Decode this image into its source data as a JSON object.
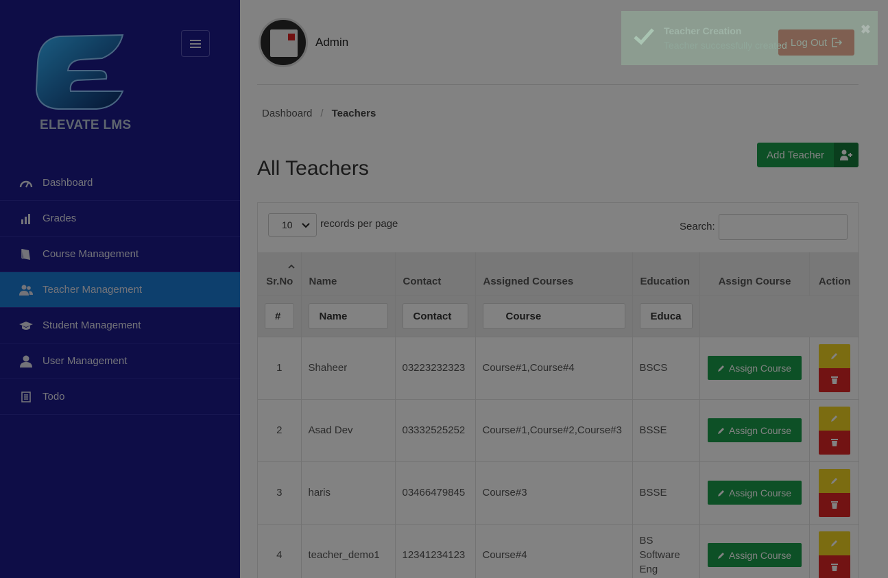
{
  "brand": {
    "logo_text": "ELEVATE LMS"
  },
  "sidebar": {
    "items": [
      {
        "label": "Dashboard",
        "icon": "dashboard-gauge-icon"
      },
      {
        "label": "Grades",
        "icon": "bar-chart-icon"
      },
      {
        "label": "Course Management",
        "icon": "book-icon"
      },
      {
        "label": "Teacher Management",
        "icon": "users-icon",
        "active": true
      },
      {
        "label": "Student Management",
        "icon": "graduation-cap-icon"
      },
      {
        "label": "User Management",
        "icon": "user-icon"
      },
      {
        "label": "Todo",
        "icon": "list-icon"
      }
    ]
  },
  "header": {
    "user_name": "Admin",
    "logout_label": "Log Out"
  },
  "breadcrumb": {
    "home": "Dashboard",
    "separator": "/",
    "current": "Teachers"
  },
  "page": {
    "title": "All Teachers",
    "add_button": "Add Teacher"
  },
  "table_controls": {
    "page_length": "10",
    "records_label": "records per page",
    "search_label": "Search:"
  },
  "table": {
    "columns": [
      "Sr.No",
      "Name",
      "Contact",
      "Assigned Courses",
      "Education",
      "Assign Course",
      "Action"
    ],
    "filters": [
      "#",
      "Name",
      "Contact",
      "Course",
      "Educa"
    ],
    "assign_label": "Assign Course",
    "rows": [
      {
        "sr": "1",
        "name": "Shaheer",
        "contact": "03223232323",
        "courses": "Course#1,Course#4",
        "education": "BSCS"
      },
      {
        "sr": "2",
        "name": "Asad Dev",
        "contact": "03332525252",
        "courses": "Course#1,Course#2,Course#3",
        "education": "BSSE"
      },
      {
        "sr": "3",
        "name": "haris",
        "contact": "03466479845",
        "courses": "Course#3",
        "education": "BSSE"
      },
      {
        "sr": "4",
        "name": "teacher_demo1",
        "contact": "12341234123",
        "courses": "Course#4",
        "education": "BS Software Eng"
      }
    ]
  },
  "toast": {
    "title": "Teacher Creation",
    "message": "Teacher successfully created"
  },
  "colors": {
    "sidebar": "#1c1a8c",
    "active_nav": "#1a7dd6",
    "success": "#1b9e4b",
    "danger": "#e02626",
    "warning": "#f2d522"
  }
}
